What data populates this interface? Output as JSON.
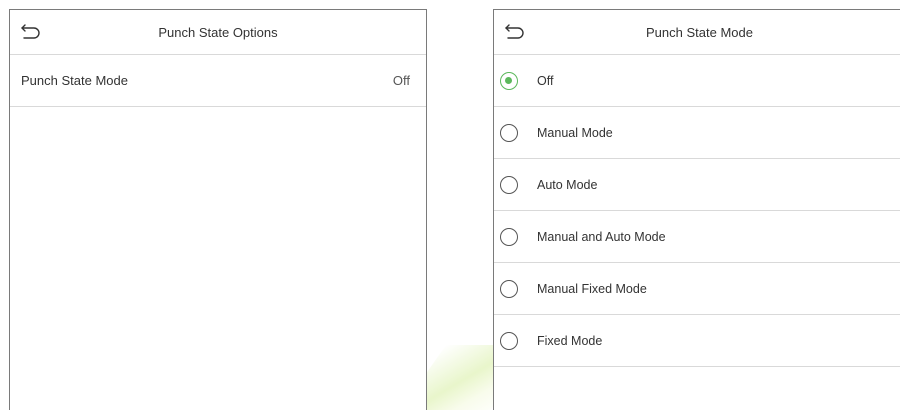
{
  "left_screen": {
    "title": "Punch State Options",
    "items": [
      {
        "label": "Punch State Mode",
        "value": "Off"
      }
    ]
  },
  "right_screen": {
    "title": "Punch State Mode",
    "selected_index": 0,
    "accent_color": "#5cb85c",
    "options": [
      {
        "label": "Off",
        "selected": true
      },
      {
        "label": "Manual Mode",
        "selected": false
      },
      {
        "label": "Auto Mode",
        "selected": false
      },
      {
        "label": "Manual and Auto Mode",
        "selected": false
      },
      {
        "label": "Manual Fixed Mode",
        "selected": false
      },
      {
        "label": "Fixed Mode",
        "selected": false
      }
    ]
  }
}
